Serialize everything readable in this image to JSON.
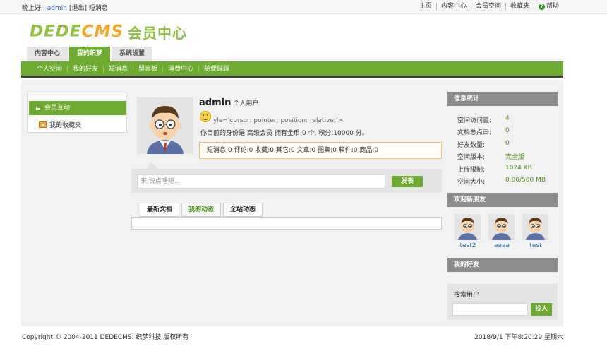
{
  "topbar": {
    "greeting": "晚上好,",
    "username": "admin",
    "logout": "[退出]",
    "messages": "短消息",
    "links": [
      "主页",
      "内容中心",
      "会员空间",
      "收藏夹"
    ],
    "help": "帮助"
  },
  "logo": {
    "part1": "DEDE",
    "part2": "CMS",
    "suffix": "会员中心"
  },
  "tabs": [
    {
      "label": "内容中心",
      "active": false
    },
    {
      "label": "我的织梦",
      "active": true
    },
    {
      "label": "系统设置",
      "active": false
    }
  ],
  "subnav": [
    "个人空间",
    "我的好友",
    "短消息",
    "留言板",
    "消费中心",
    "随便踩踩"
  ],
  "sidebar": {
    "section": "会员互动",
    "items": [
      "我的收藏夹"
    ]
  },
  "profile": {
    "name": "admin",
    "type": "个人用户",
    "stray_text": "yle='cursor: pointer; position: relative;'>",
    "identity": "你目前的身份是:高级会员 拥有金币:0 个, 积分:10000 分。",
    "stats": "短消息:0 评论:0 收藏:0 其它:0 文章:0 图集:0 软件:0 商品:0"
  },
  "post": {
    "placeholder": "来,说点啥吧...",
    "button": "发表"
  },
  "feed_tabs": [
    {
      "label": "最新文档",
      "active": false
    },
    {
      "label": "我的动态",
      "active": true
    },
    {
      "label": "全站动态",
      "active": false
    }
  ],
  "info": {
    "title": "信息统计",
    "rows": [
      {
        "k": "空间访问量:",
        "v": "4"
      },
      {
        "k": "文档总点击:",
        "v": "0"
      },
      {
        "k": "好友数量:",
        "v": "0"
      },
      {
        "k": "空间版本:",
        "v": "完全版"
      },
      {
        "k": "上传限制:",
        "v": "1024 KB"
      },
      {
        "k": "空间大小:",
        "v": "0.00/500 MB"
      }
    ]
  },
  "new_friends": {
    "title": "欢迎新朋友",
    "users": [
      "test2",
      "aaaa",
      "test"
    ]
  },
  "my_friends": {
    "title": "我的好友"
  },
  "search": {
    "label": "搜索用户",
    "button": "找人"
  },
  "footer": {
    "copyright": "Copyright © 2004-2011 DEDECMS. 织梦科技 版权所有",
    "datetime": "2018/9/1 下午8:20:29 星期六"
  }
}
